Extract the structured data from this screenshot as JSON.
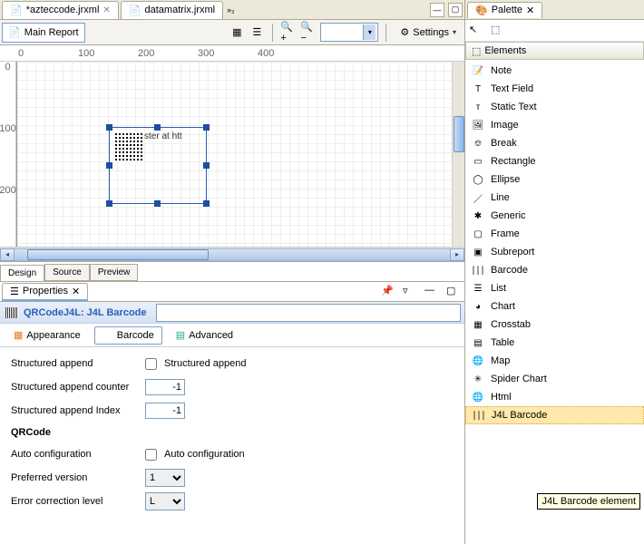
{
  "editor": {
    "tabs": [
      {
        "label": "*azteccode.jrxml"
      },
      {
        "label": "datamatrix.jrxml"
      }
    ]
  },
  "reportBar": {
    "mainReport": "Main Report",
    "settings": "Settings"
  },
  "ruler": {
    "h": [
      "0",
      "100",
      "200",
      "300",
      "400"
    ],
    "v": [
      "0",
      "100",
      "200"
    ]
  },
  "canvas": {
    "elementText": "ster at htt"
  },
  "bottomTabs": {
    "design": "Design",
    "source": "Source",
    "preview": "Preview"
  },
  "properties": {
    "viewTab": "Properties",
    "title": "QRCodeJ4L: J4L Barcode",
    "subtabs": {
      "appearance": "Appearance",
      "barcode": "Barcode",
      "advanced": "Advanced"
    },
    "fields": {
      "structAppendLabel": "Structured append",
      "structAppendCheck": "Structured append",
      "structAppendCounterLabel": "Structured append counter",
      "structAppendCounterVal": "-1",
      "structAppendIndexLabel": "Structured append Index",
      "structAppendIndexVal": "-1",
      "qrcodeSection": "QRCode",
      "autoConfigLabel": "Auto configuration",
      "autoConfigCheck": "Auto configuration",
      "prefVersionLabel": "Preferred version",
      "prefVersionVal": "1",
      "errCorrLabel": "Error correction level",
      "errCorrVal": "L"
    }
  },
  "palette": {
    "tab": "Palette",
    "drawer": "Elements",
    "items": [
      {
        "name": "Note",
        "icon": "note"
      },
      {
        "name": "Text Field",
        "icon": "textfield"
      },
      {
        "name": "Static Text",
        "icon": "statictext"
      },
      {
        "name": "Image",
        "icon": "image"
      },
      {
        "name": "Break",
        "icon": "break"
      },
      {
        "name": "Rectangle",
        "icon": "rect"
      },
      {
        "name": "Ellipse",
        "icon": "ellipse"
      },
      {
        "name": "Line",
        "icon": "line"
      },
      {
        "name": "Generic",
        "icon": "generic"
      },
      {
        "name": "Frame",
        "icon": "frame"
      },
      {
        "name": "Subreport",
        "icon": "subreport"
      },
      {
        "name": "Barcode",
        "icon": "barcode"
      },
      {
        "name": "List",
        "icon": "list"
      },
      {
        "name": "Chart",
        "icon": "chart"
      },
      {
        "name": "Crosstab",
        "icon": "crosstab"
      },
      {
        "name": "Table",
        "icon": "table"
      },
      {
        "name": "Map",
        "icon": "map"
      },
      {
        "name": "Spider Chart",
        "icon": "spider"
      },
      {
        "name": "Html",
        "icon": "html"
      },
      {
        "name": "J4L Barcode",
        "icon": "barcode",
        "hl": true
      }
    ],
    "tooltip": "J4L Barcode element"
  }
}
